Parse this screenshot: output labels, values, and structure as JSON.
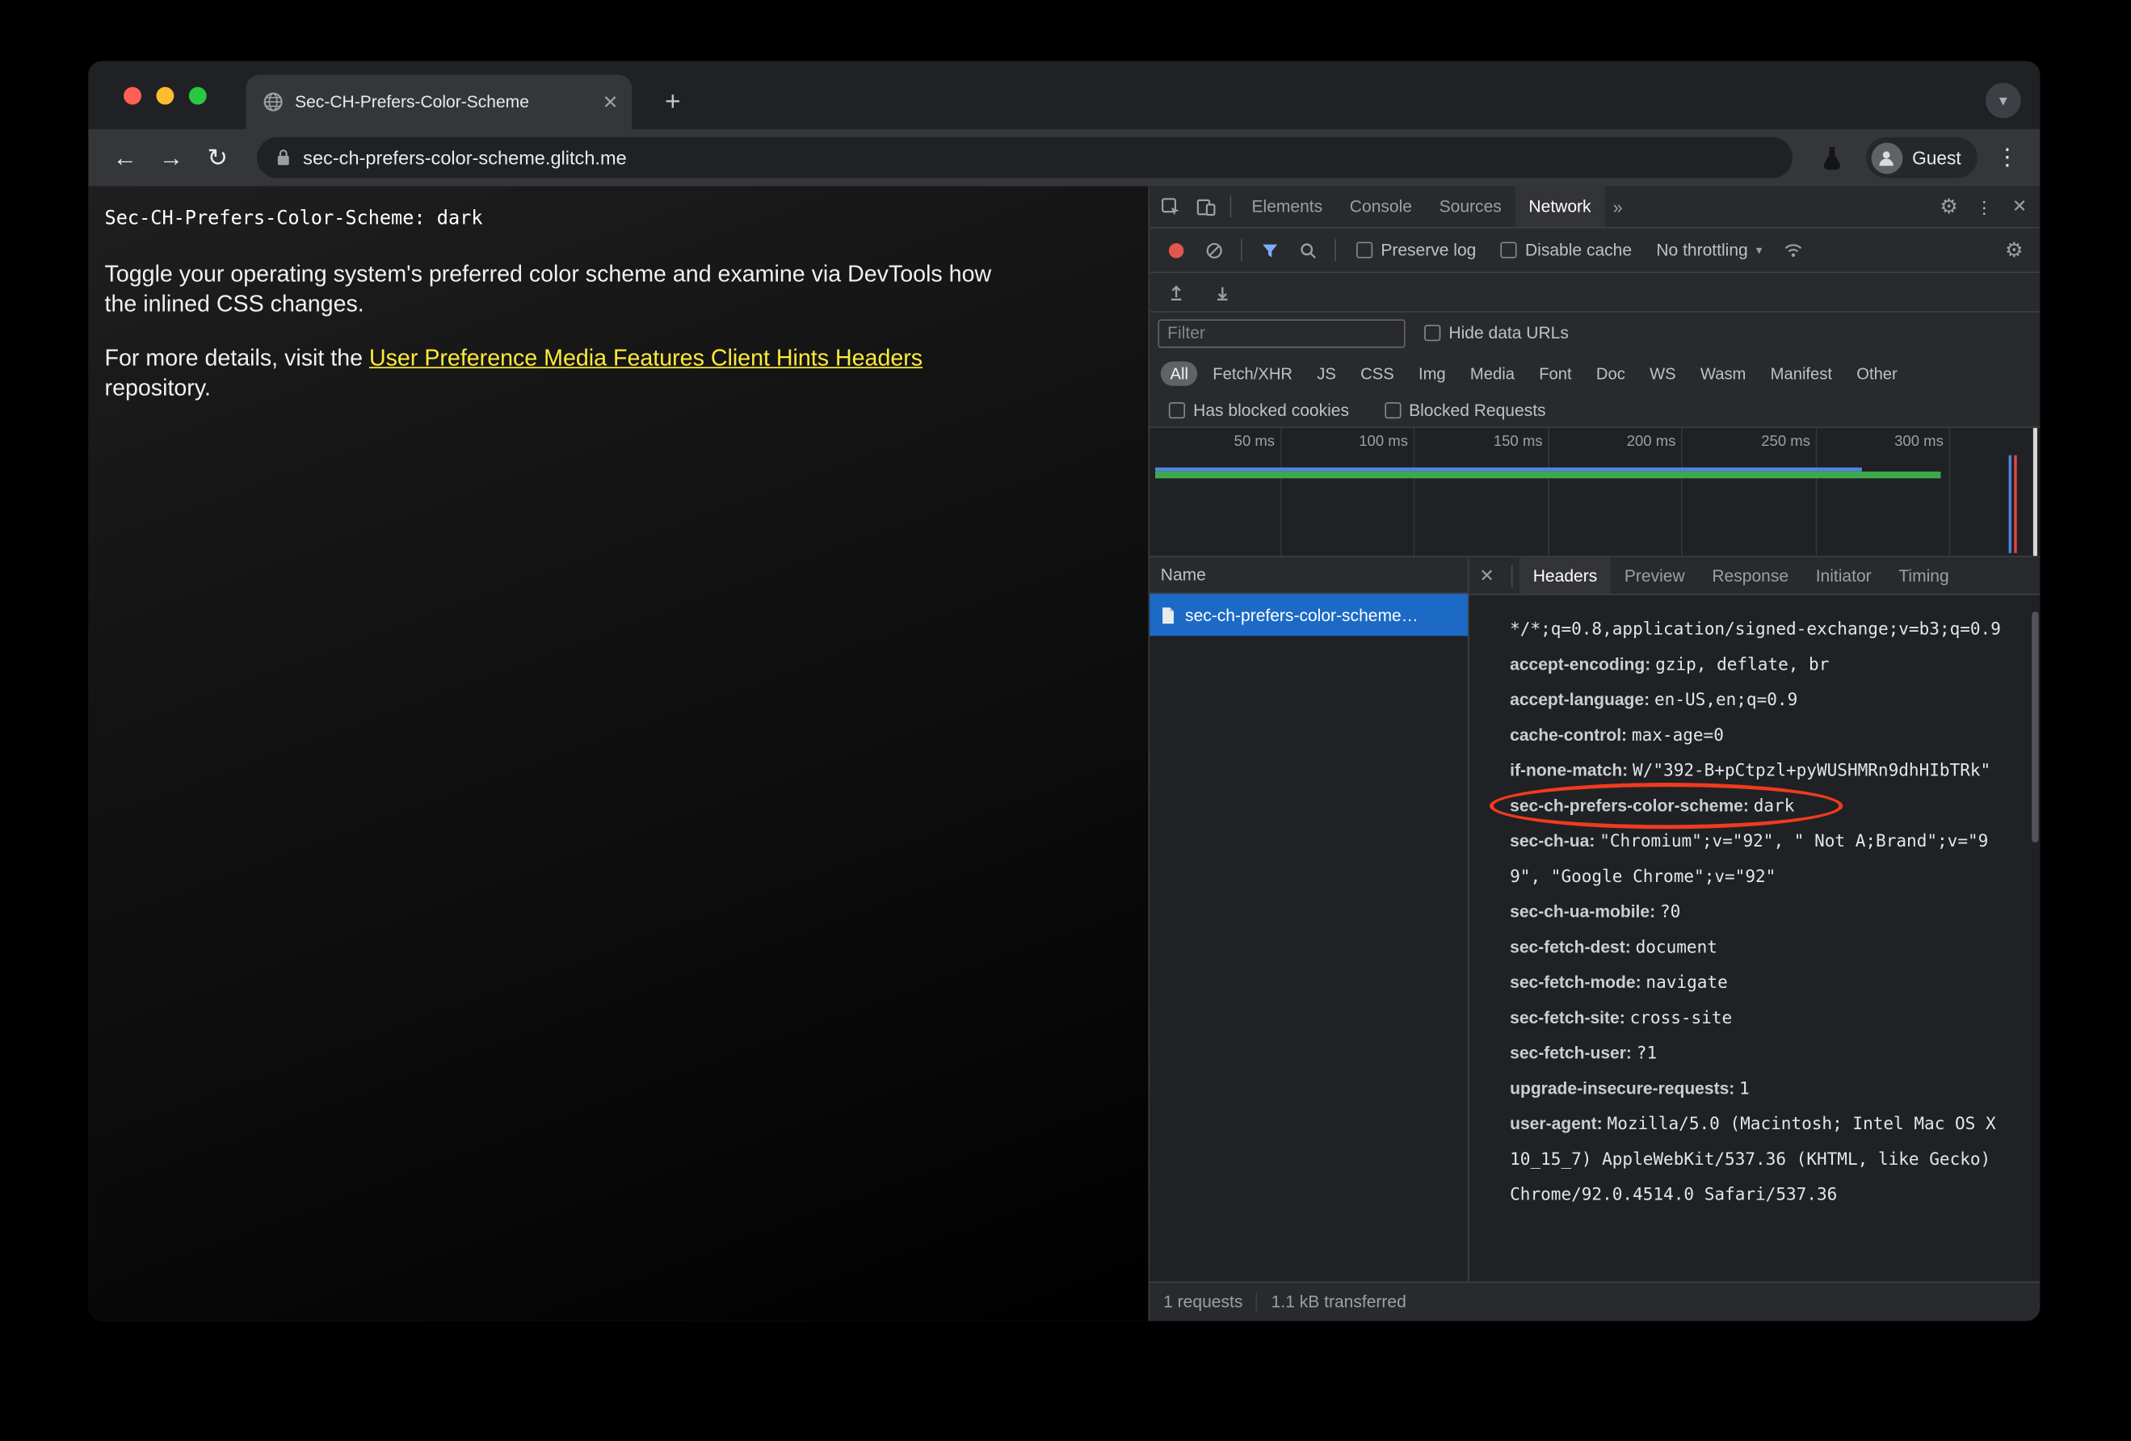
{
  "window": {
    "tab_title": "Sec-CH-Prefers-Color-Scheme",
    "new_tab": "+",
    "url": "sec-ch-prefers-color-scheme.glitch.me",
    "profile_label": "Guest",
    "traffic_light_colors": [
      "#ff5f57",
      "#febc2e",
      "#28c840"
    ]
  },
  "page": {
    "mono_line": "Sec-CH-Prefers-Color-Scheme: dark",
    "paragraph1": "Toggle your operating system's preferred color scheme and examine via DevTools how the inlined CSS changes.",
    "paragraph2_prefix": "For more details, visit the ",
    "link_text": "User Preference Media Features Client Hints Headers",
    "paragraph2_suffix": " repository.",
    "link_color": "#ffeb3b"
  },
  "devtools": {
    "main_tabs": [
      "Elements",
      "Console",
      "Sources",
      "Network"
    ],
    "active_main_tab": "Network",
    "more_tabs_chevron": "»",
    "network_toolbar": {
      "preserve_log": "Preserve log",
      "disable_cache": "Disable cache",
      "throttling": "No throttling"
    },
    "filter": {
      "placeholder": "Filter",
      "hide_data_urls": "Hide data URLs"
    },
    "type_pills": [
      "All",
      "Fetch/XHR",
      "JS",
      "CSS",
      "Img",
      "Media",
      "Font",
      "Doc",
      "WS",
      "Wasm",
      "Manifest",
      "Other"
    ],
    "active_pill": "All",
    "blocked_filters": [
      "Has blocked cookies",
      "Blocked Requests"
    ],
    "timeline_ticks": [
      "50 ms",
      "100 ms",
      "150 ms",
      "200 ms",
      "250 ms",
      "300 ms"
    ],
    "requests_table": {
      "name_header": "Name",
      "rows": [
        {
          "name": "sec-ch-prefers-color-scheme…",
          "selected": true
        }
      ]
    },
    "detail_tabs": [
      "Headers",
      "Preview",
      "Response",
      "Initiator",
      "Timing"
    ],
    "active_detail_tab": "Headers",
    "highlight_color": "#ef3b1f",
    "selected_row_color": "#1c6ac6",
    "headers_list": [
      {
        "name": "",
        "value": "*/*;q=0.8,application/signed-exchange;v=b3;q=0.9"
      },
      {
        "name": "accept-encoding:",
        "value": "gzip, deflate, br"
      },
      {
        "name": "accept-language:",
        "value": "en-US,en;q=0.9"
      },
      {
        "name": "cache-control:",
        "value": "max-age=0"
      },
      {
        "name": "if-none-match:",
        "value": "W/\"392-B+pCtpzl+pyWUSHMRn9dhHIbTRk\""
      },
      {
        "name": "sec-ch-prefers-color-scheme:",
        "value": "dark",
        "highlighted": true
      },
      {
        "name": "sec-ch-ua:",
        "value": "\"Chromium\";v=\"92\", \" Not A;Brand\";v=\"99\", \"Google Chrome\";v=\"92\""
      },
      {
        "name": "sec-ch-ua-mobile:",
        "value": "?0"
      },
      {
        "name": "sec-fetch-dest:",
        "value": "document"
      },
      {
        "name": "sec-fetch-mode:",
        "value": "navigate"
      },
      {
        "name": "sec-fetch-site:",
        "value": "cross-site"
      },
      {
        "name": "sec-fetch-user:",
        "value": "?1"
      },
      {
        "name": "upgrade-insecure-requests:",
        "value": "1"
      },
      {
        "name": "user-agent:",
        "value": "Mozilla/5.0 (Macintosh; Intel Mac OS X 10_15_7) AppleWebKit/537.36 (KHTML, like Gecko) Chrome/92.0.4514.0 Safari/537.36"
      }
    ],
    "status_bar": {
      "requests": "1 requests",
      "transferred": "1.1 kB transferred"
    }
  }
}
